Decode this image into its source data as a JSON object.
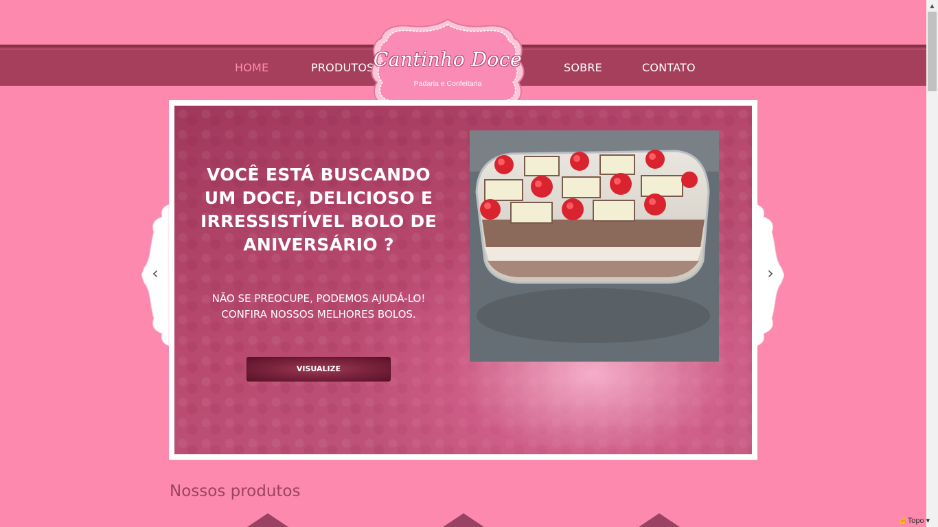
{
  "nav": {
    "items": [
      {
        "label": "HOME",
        "active": true
      },
      {
        "label": "PRODUTOS",
        "active": false
      },
      {
        "label": "SOBRE",
        "active": false
      },
      {
        "label": "CONTATO",
        "active": false
      }
    ]
  },
  "logo": {
    "title": "Cantinho Doce",
    "subtitle": "Padaria e Confeitaria"
  },
  "slider": {
    "headline": "VOCÊ ESTÁ BUSCANDO UM DOCE, DELICIOSO E IRRESSISTÍVEL BOLO DE ANIVERSÁRIO ?",
    "text_line1": "NÃO SE PREOCUPE, PODEMOS AJUDÁ-LO!",
    "text_line2": "CONFIRA NOSSOS MELHORES BOLOS.",
    "button_label": "VISUALIZE",
    "prev_icon": "‹",
    "next_icon": "›"
  },
  "products": {
    "title": "Nossos produtos"
  },
  "footer": {
    "top_link": "Topo"
  },
  "colors": {
    "background": "#fd8aae",
    "navbar": "#a63f5c",
    "active_link": "#ff8db2",
    "heading": "#9a4263"
  }
}
